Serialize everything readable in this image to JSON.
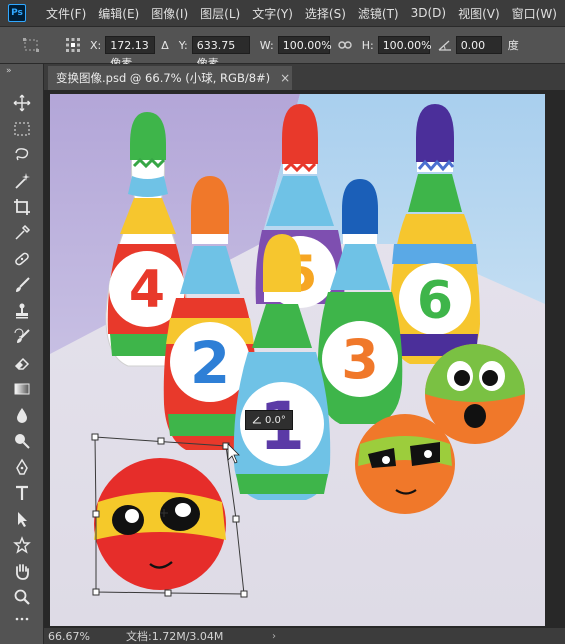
{
  "app": {
    "logo": "Ps"
  },
  "menu": [
    "文件(F)",
    "编辑(E)",
    "图像(I)",
    "图层(L)",
    "文字(Y)",
    "选择(S)",
    "滤镜(T)",
    "3D(D)",
    "视图(V)",
    "窗口(W)"
  ],
  "options": {
    "x_label": "X:",
    "x_value": "172.13 像素",
    "delta_label": "Δ",
    "y_label": "Y:",
    "y_value": "633.75 像素",
    "w_label": "W:",
    "w_value": "100.00%",
    "h_label": "H:",
    "h_value": "100.00%",
    "angle_value": "0.00",
    "angle_unit": "度"
  },
  "document": {
    "tab_title": "变换图像.psd @ 66.7% (小球, RGB/8#)",
    "close_glyph": "×"
  },
  "canvas": {
    "angle_tip": "0.0°",
    "pin_numbers": [
      "4",
      "5",
      "6",
      "2",
      "3",
      "1"
    ]
  },
  "status": {
    "zoom": "66.67%",
    "doc_info": "文档:1.72M/3.04M",
    "arrow": "›"
  },
  "tools": [
    "move-icon",
    "marquee-icon",
    "lasso-icon",
    "magic-wand-icon",
    "crop-icon",
    "eyedropper-icon",
    "healing-brush-icon",
    "brush-icon",
    "clone-stamp-icon",
    "history-brush-icon",
    "eraser-icon",
    "gradient-icon",
    "blur-icon",
    "dodge-icon",
    "pen-icon",
    "type-icon",
    "path-selection-icon",
    "shape-icon",
    "hand-icon",
    "zoom-icon"
  ],
  "colors": {
    "accent": "#31a8ff",
    "menu_bg": "#3c3c3c",
    "panel_bg": "#535353"
  }
}
